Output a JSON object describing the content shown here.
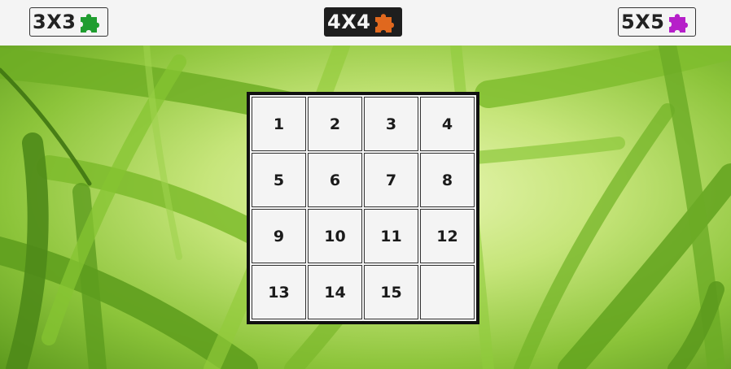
{
  "size_buttons": [
    {
      "label": "3X3",
      "icon": "puzzle-piece-icon",
      "icon_color": "#1f9d2f",
      "active": false
    },
    {
      "label": "4X4",
      "icon": "puzzle-piece-icon",
      "icon_color": "#e0681e",
      "active": true
    },
    {
      "label": "5X5",
      "icon": "puzzle-piece-icon",
      "icon_color": "#b61fc9",
      "active": false
    }
  ],
  "board": {
    "size": 4,
    "tiles": [
      "1",
      "2",
      "3",
      "4",
      "5",
      "6",
      "7",
      "8",
      "9",
      "10",
      "11",
      "12",
      "13",
      "14",
      "15",
      ""
    ]
  },
  "colors": {
    "topbar_bg": "#f4f4f4",
    "active_button_bg": "#1e1e1e",
    "tile_bg": "#f4f4f4",
    "board_border": "#111111"
  }
}
